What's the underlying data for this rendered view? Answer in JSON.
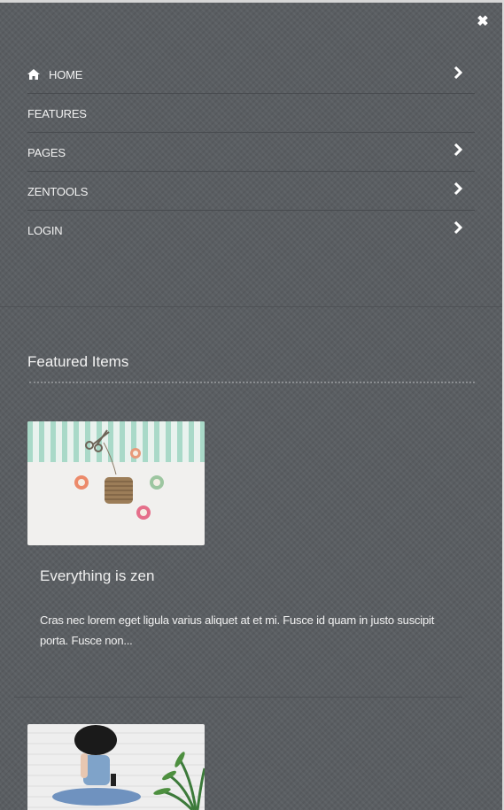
{
  "close": {
    "icon": "close-icon"
  },
  "menu": {
    "items": [
      {
        "label": "HOME",
        "icon": "home-icon",
        "has_submenu": true
      },
      {
        "label": "FEATURES",
        "has_submenu": false
      },
      {
        "label": "PAGES",
        "has_submenu": true
      },
      {
        "label": "ZENTOOLS",
        "has_submenu": true
      },
      {
        "label": "LOGIN",
        "has_submenu": true
      }
    ]
  },
  "featured": {
    "title": "Featured Items",
    "items": [
      {
        "title": "Everything is zen",
        "description": "Cras nec lorem eget ligula varius aliquet at et mi. Fusce id quam in justo suscipit porta. Fusce non...",
        "image": "washi-tape-and-twine-photo"
      },
      {
        "image": "person-with-hat-and-plant-photo"
      }
    ]
  },
  "colors": {
    "background": "#5a5e62",
    "text": "#ffffff"
  }
}
